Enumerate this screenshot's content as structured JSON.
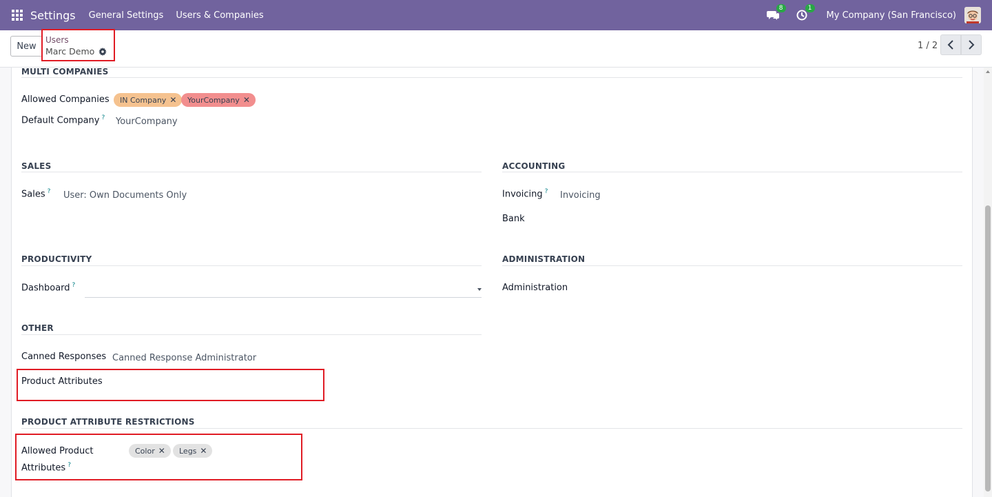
{
  "navbar": {
    "brand": "Settings",
    "menu": [
      "General Settings",
      "Users & Companies"
    ],
    "messages_badge": "8",
    "activity_badge": "1",
    "company": "My Company (San Francisco)",
    "bg_color": "#71639e"
  },
  "control": {
    "new_label": "New",
    "breadcrumb_parent": "Users",
    "breadcrumb_current": "Marc Demo",
    "pager": "1 / 2"
  },
  "form": {
    "multi_companies": {
      "title": "MULTI COMPANIES",
      "allowed_label": "Allowed Companies",
      "allowed_tags": [
        "IN Company",
        "YourCompany"
      ],
      "default_label": "Default Company",
      "default_value": "YourCompany"
    },
    "sales": {
      "title": "SALES",
      "label": "Sales",
      "value": "User: Own Documents Only"
    },
    "accounting": {
      "title": "ACCOUNTING",
      "invoicing_label": "Invoicing",
      "invoicing_value": "Invoicing",
      "bank_label": "Bank"
    },
    "productivity": {
      "title": "PRODUCTIVITY",
      "dashboard_label": "Dashboard",
      "dashboard_value": ""
    },
    "administration": {
      "title": "ADMINISTRATION",
      "label": "Administration"
    },
    "other": {
      "title": "OTHER",
      "canned_label": "Canned Responses",
      "canned_value": "Canned Response Administrator",
      "product_attr_label": "Product Attributes"
    },
    "restrictions": {
      "title": "PRODUCT ATTRIBUTE RESTRICTIONS",
      "allowed_label_line1": "Allowed Product",
      "allowed_label_line2": "Attributes",
      "tags": [
        "Color",
        "Legs"
      ]
    }
  },
  "help_mark": "?",
  "tag_remove": "✕"
}
